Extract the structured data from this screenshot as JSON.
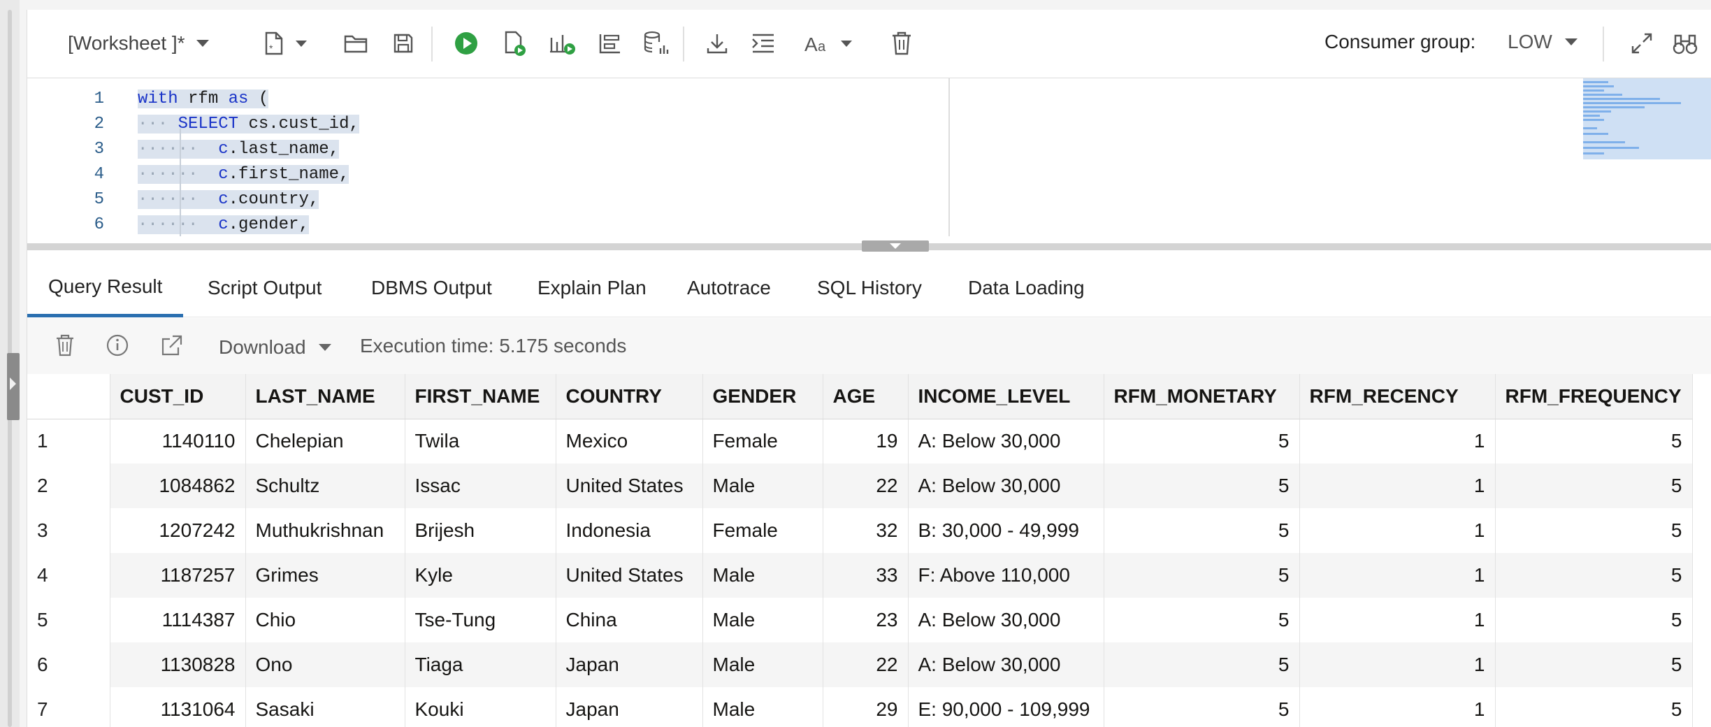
{
  "toolbar": {
    "worksheet_label": "[Worksheet ]*",
    "consumer_group_label": "Consumer group:",
    "consumer_group_value": "LOW",
    "icons": [
      "new-file-icon",
      "open-folder-icon",
      "save-icon",
      "run-statement-icon",
      "run-script-icon",
      "explain-plan-icon",
      "autotrace-icon",
      "sql-tuning-icon",
      "download-icon",
      "format-icon",
      "font-size-icon",
      "clear-icon",
      "expand-icon",
      "binoculars-icon"
    ]
  },
  "editor": {
    "lines": [
      {
        "n": "1",
        "text": "with rfm as ("
      },
      {
        "n": "2",
        "text": "SELECT cs.cust_id,"
      },
      {
        "n": "3",
        "text": "c.last_name,"
      },
      {
        "n": "4",
        "text": "c.first_name,"
      },
      {
        "n": "5",
        "text": "c.country,"
      },
      {
        "n": "6",
        "text": "c.gender,"
      }
    ]
  },
  "tabs": [
    {
      "label": "Query Result",
      "active": true
    },
    {
      "label": "Script Output"
    },
    {
      "label": "DBMS Output"
    },
    {
      "label": "Explain Plan"
    },
    {
      "label": "Autotrace"
    },
    {
      "label": "SQL History"
    },
    {
      "label": "Data Loading"
    }
  ],
  "results_toolbar": {
    "download_label": "Download",
    "execution_time": "Execution time: 5.175 seconds"
  },
  "grid": {
    "columns": [
      "CUST_ID",
      "LAST_NAME",
      "FIRST_NAME",
      "COUNTRY",
      "GENDER",
      "AGE",
      "INCOME_LEVEL",
      "RFM_MONETARY",
      "RFM_RECENCY",
      "RFM_FREQUENCY"
    ],
    "rows": [
      [
        "1",
        "1140110",
        "Chelepian",
        "Twila",
        "Mexico",
        "Female",
        "19",
        "A: Below 30,000",
        "5",
        "1",
        "5"
      ],
      [
        "2",
        "1084862",
        "Schultz",
        "Issac",
        "United States",
        "Male",
        "22",
        "A: Below 30,000",
        "5",
        "1",
        "5"
      ],
      [
        "3",
        "1207242",
        "Muthukrishnan",
        "Brijesh",
        "Indonesia",
        "Female",
        "32",
        "B: 30,000 - 49,999",
        "5",
        "1",
        "5"
      ],
      [
        "4",
        "1187257",
        "Grimes",
        "Kyle",
        "United States",
        "Male",
        "33",
        "F: Above 110,000",
        "5",
        "1",
        "5"
      ],
      [
        "5",
        "1114387",
        "Chio",
        "Tse-Tung",
        "China",
        "Male",
        "23",
        "A: Below 30,000",
        "5",
        "1",
        "5"
      ],
      [
        "6",
        "1130828",
        "Ono",
        "Tiaga",
        "Japan",
        "Male",
        "22",
        "A: Below 30,000",
        "5",
        "1",
        "5"
      ],
      [
        "7",
        "1131064",
        "Sasaki",
        "Kouki",
        "Japan",
        "Male",
        "29",
        "E: 90,000 - 109,999",
        "5",
        "1",
        "5"
      ]
    ]
  }
}
